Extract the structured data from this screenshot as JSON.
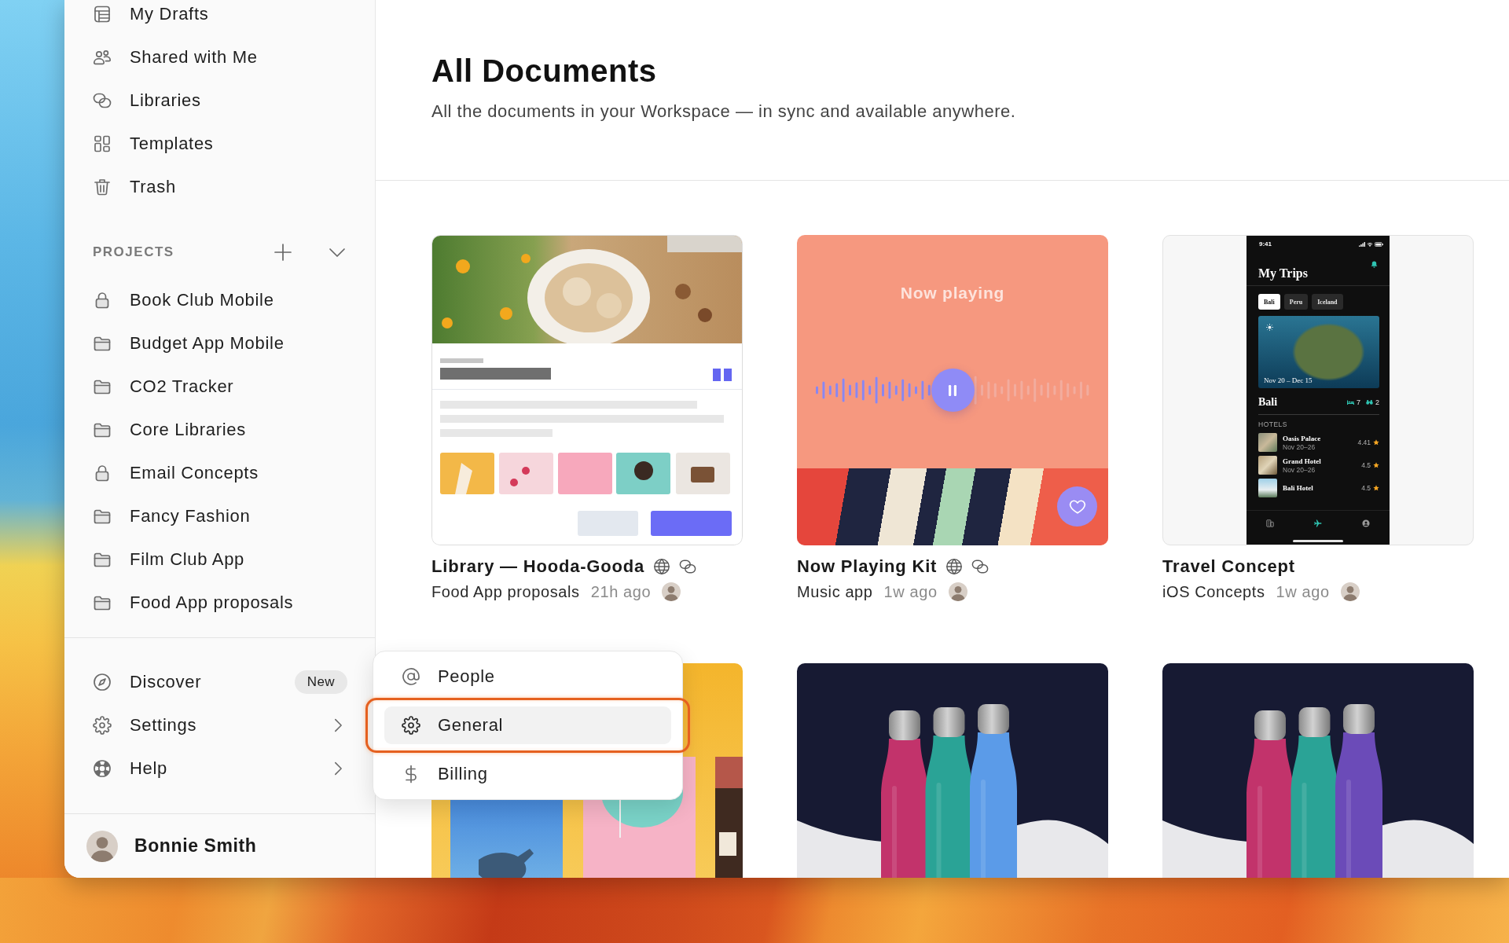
{
  "sidebar": {
    "nav": [
      {
        "label": "My Drafts"
      },
      {
        "label": "Shared with Me"
      },
      {
        "label": "Libraries"
      },
      {
        "label": "Templates"
      },
      {
        "label": "Trash"
      }
    ],
    "projects": {
      "label": "PROJECTS",
      "expanded": true,
      "items": [
        {
          "label": "Book Club Mobile",
          "locked": true
        },
        {
          "label": "Budget App Mobile",
          "locked": false
        },
        {
          "label": "CO2 Tracker",
          "locked": false
        },
        {
          "label": "Core Libraries",
          "locked": false
        },
        {
          "label": "Email Concepts",
          "locked": true
        },
        {
          "label": "Fancy Fashion",
          "locked": false
        },
        {
          "label": "Film Club App",
          "locked": false
        },
        {
          "label": "Food App proposals",
          "locked": false
        }
      ]
    },
    "footer_nav": [
      {
        "label": "Discover",
        "badge": "New",
        "submenu": false
      },
      {
        "label": "Settings",
        "submenu": true
      },
      {
        "label": "Help",
        "submenu": true
      }
    ],
    "user": {
      "name": "Bonnie Smith"
    }
  },
  "main": {
    "title": "All Documents",
    "subtitle": "All the documents in your Workspace — in sync and available anywhere.",
    "documents": [
      {
        "preview": {
          "kind": "document"
        },
        "title": "Library — Hooda-Gooda",
        "public": true,
        "library": true,
        "project": "Food App proposals",
        "time": "21h ago"
      },
      {
        "preview": {
          "kind": "player",
          "heading": "Now playing",
          "level": 0.5
        },
        "title": "Now Playing Kit",
        "public": true,
        "library": true,
        "project": "Music app",
        "time": "1w ago"
      },
      {
        "preview": {
          "kind": "phone",
          "time": "9:41",
          "title": "My Trips",
          "tabs": [
            {
              "label": "Bali",
              "selected": true
            },
            {
              "label": "Peru",
              "selected": false
            },
            {
              "label": "Iceland",
              "selected": false
            }
          ],
          "caption": "Nov 20 – Dec 15",
          "place": "Bali",
          "stats": [
            "7",
            "2"
          ],
          "section": "HOTELS",
          "hotels": [
            {
              "name": "Oasis Palace",
              "dates": "Nov 20–26",
              "rating": "4.41"
            },
            {
              "name": "Grand Hotel",
              "dates": "Nov 20–26",
              "rating": "4.5"
            },
            {
              "name": "Bali Hotel",
              "rating": "4.5"
            }
          ],
          "tab_bar": [
            {
              "selected": false
            },
            {
              "selected": true
            },
            {
              "selected": false
            }
          ]
        },
        "title": "Travel Concept",
        "public": false,
        "library": false,
        "project": "iOS Concepts",
        "time": "1w ago"
      },
      {
        "preview": {
          "kind": "books"
        }
      },
      {
        "preview": {
          "kind": "bottles",
          "bottles": [
            {
              "color": "#c2336b"
            },
            {
              "color": "#2aa396"
            },
            {
              "color": "#5b9be8"
            }
          ]
        }
      },
      {
        "preview": {
          "kind": "bottles",
          "bottles": [
            {
              "color": "#c2336b"
            },
            {
              "color": "#2aa396"
            },
            {
              "color": "#6b4bb8"
            }
          ]
        }
      }
    ]
  },
  "settings_menu": {
    "items": [
      {
        "label": "People",
        "selected": false,
        "outlined": false
      },
      {
        "label": "General",
        "selected": true,
        "outlined": true
      },
      {
        "label": "Billing",
        "selected": false,
        "outlined": false
      }
    ]
  }
}
